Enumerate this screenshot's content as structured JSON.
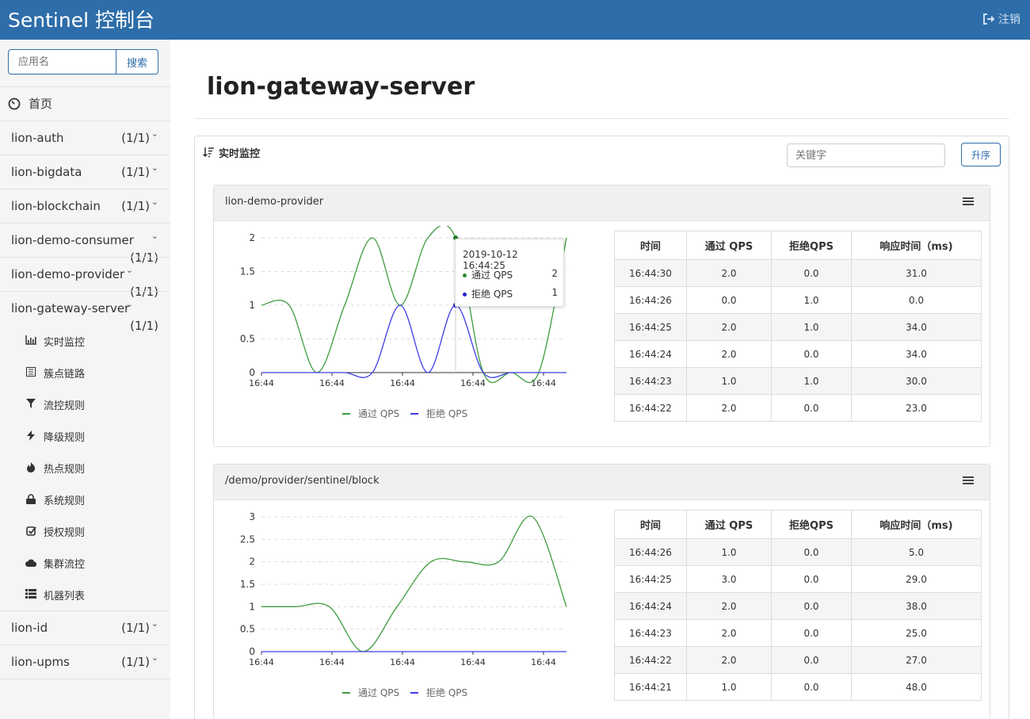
{
  "app": {
    "title": "Sentinel 控制台",
    "logout_label": "注销"
  },
  "search": {
    "placeholder": "应用名",
    "button": "搜索"
  },
  "sidebar": {
    "home": "首页",
    "apps": [
      {
        "name": "lion-auth",
        "count": "(1/1)"
      },
      {
        "name": "lion-bigdata",
        "count": "(1/1)"
      },
      {
        "name": "lion-blockchain",
        "count": "(1/1)"
      },
      {
        "name": "lion-demo-consumer",
        "count": "(1/1)"
      },
      {
        "name": "lion-demo-provider",
        "count": "(1/1)"
      },
      {
        "name": "lion-gateway-server",
        "count": "(1/1)"
      },
      {
        "name": "lion-id",
        "count": "(1/1)"
      },
      {
        "name": "lion-upms",
        "count": "(1/1)"
      }
    ],
    "submenu": [
      {
        "label": "实时监控",
        "icon": "bar-chart-icon"
      },
      {
        "label": "簇点链路",
        "icon": "list-icon"
      },
      {
        "label": "流控规则",
        "icon": "filter-icon"
      },
      {
        "label": "降级规则",
        "icon": "bolt-icon"
      },
      {
        "label": "热点规则",
        "icon": "fire-icon"
      },
      {
        "label": "系统规则",
        "icon": "lock-icon"
      },
      {
        "label": "授权规则",
        "icon": "check-square-icon"
      },
      {
        "label": "集群流控",
        "icon": "cloud-icon"
      },
      {
        "label": "机器列表",
        "icon": "th-list-icon"
      }
    ]
  },
  "page": {
    "title": "lion-gateway-server"
  },
  "monitor": {
    "heading": "实时监控",
    "keyword_placeholder": "关键字",
    "sort_button": "升序"
  },
  "colors": {
    "brand": "#2d6da9",
    "pass": "#2e8b2e",
    "block": "#3a3ae6"
  },
  "table_headers": [
    "时间",
    "通过 QPS",
    "拒绝QPS",
    "响应时间（ms)"
  ],
  "resources": [
    {
      "name": "lion-demo-provider",
      "rows": [
        [
          "16:44:30",
          "2.0",
          "0.0",
          "31.0"
        ],
        [
          "16:44:26",
          "0.0",
          "1.0",
          "0.0"
        ],
        [
          "16:44:25",
          "2.0",
          "1.0",
          "34.0"
        ],
        [
          "16:44:24",
          "2.0",
          "0.0",
          "34.0"
        ],
        [
          "16:44:23",
          "1.0",
          "1.0",
          "30.0"
        ],
        [
          "16:44:22",
          "2.0",
          "0.0",
          "23.0"
        ]
      ],
      "chart_data": {
        "type": "line",
        "x_tick_labels": [
          "16:44",
          "16:44",
          "16:44",
          "16:44",
          "16:44"
        ],
        "y_ticks": [
          0,
          0.5,
          1,
          1.5,
          2
        ],
        "ylim": [
          0,
          2
        ],
        "x": [
          0,
          1,
          2,
          3,
          4,
          5,
          6,
          7,
          8,
          9,
          10,
          11
        ],
        "series": [
          {
            "name": "通过 QPS",
            "values": [
              1,
              1,
              0,
              1,
              2,
              1,
              2,
              2,
              0,
              0,
              0,
              2
            ]
          },
          {
            "name": "拒绝 QPS",
            "values": [
              0,
              0,
              0,
              0,
              0,
              1,
              0,
              1,
              0,
              0,
              0,
              0
            ]
          }
        ],
        "tooltip": {
          "title": "2019-10-12 16:44:25",
          "rows": [
            [
              "通过 QPS",
              "2"
            ],
            [
              "拒绝 QPS",
              "1"
            ]
          ]
        }
      }
    },
    {
      "name": "/demo/provider/sentinel/block",
      "rows": [
        [
          "16:44:26",
          "1.0",
          "0.0",
          "5.0"
        ],
        [
          "16:44:25",
          "3.0",
          "0.0",
          "29.0"
        ],
        [
          "16:44:24",
          "2.0",
          "0.0",
          "38.0"
        ],
        [
          "16:44:23",
          "2.0",
          "0.0",
          "25.0"
        ],
        [
          "16:44:22",
          "2.0",
          "0.0",
          "27.0"
        ],
        [
          "16:44:21",
          "1.0",
          "0.0",
          "48.0"
        ]
      ],
      "chart_data": {
        "type": "line",
        "x_tick_labels": [
          "16:44",
          "16:44",
          "16:44",
          "16:44",
          "16:44"
        ],
        "y_ticks": [
          0,
          0.5,
          1,
          1.5,
          2,
          2.5,
          3
        ],
        "ylim": [
          0,
          3
        ],
        "x": [
          0,
          1,
          2,
          3,
          4,
          5,
          6,
          7,
          8,
          9
        ],
        "series": [
          {
            "name": "通过 QPS",
            "values": [
              1,
              1,
              1,
              0,
              1,
              2,
              2,
              2,
              3,
              1
            ]
          },
          {
            "name": "拒绝 QPS",
            "values": [
              0,
              0,
              0,
              0,
              0,
              0,
              0,
              0,
              0,
              0
            ]
          }
        ]
      }
    }
  ]
}
